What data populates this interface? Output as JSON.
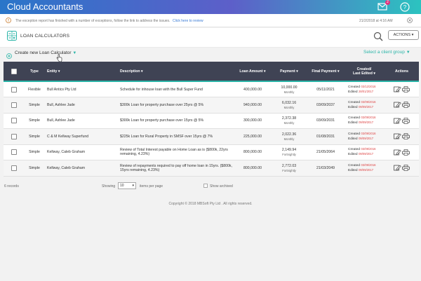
{
  "app": {
    "title": "Cloud Accountants",
    "mail_badge": "2"
  },
  "notice": {
    "message": "The exception report has finished with a number of exceptions, follow the link to address the issues.",
    "link": "Click here to review",
    "timestamp": "21/2/2018 at 4:16 AM"
  },
  "page": {
    "title": "LOAN CALCULATORS",
    "actions_label": "ACTIONS",
    "create_label": "Create new Loan Calculator",
    "client_group": "Select a client group"
  },
  "table": {
    "headers": {
      "type": "Type",
      "entity": "Entity",
      "description": "Description",
      "loan_amount": "Loan Amount",
      "payment": "Payment",
      "final_payment": "Final Payment",
      "created_line1": "Created/",
      "created_line2": "Last Edited",
      "actions": "Actions"
    },
    "rows": [
      {
        "type": "Flexible",
        "entity": "Bull Antics Pty Ltd",
        "description": "Schedule for inhouse loan with the Bull Super Fund",
        "loan_amount": "400,000.00",
        "payment": "10,000.00",
        "frequency": "Monthly",
        "final_payment": "05/11/2021",
        "created": "03/12/2016",
        "edited": "28/01/2017"
      },
      {
        "type": "Simple",
        "entity": "Bull, Ashlee Jade",
        "description": "$300k Loan for property purchase over 25yrs @ 5%",
        "loan_amount": "940,000.00",
        "payment": "6,032.16",
        "frequency": "Monthly",
        "final_payment": "03/09/2037",
        "created": "03/09/2016",
        "edited": "09/09/2017"
      },
      {
        "type": "Simple",
        "entity": "Bull, Ashlee Jade",
        "description": "$300k Loan for property purchase over 15yrs @ 5%",
        "loan_amount": "300,000.00",
        "payment": "2,372.38",
        "frequency": "Monthly",
        "final_payment": "03/09/2031",
        "created": "03/09/2016",
        "edited": "09/09/2017"
      },
      {
        "type": "Simple",
        "entity": "C & M Kellway Superfund",
        "description": "$225k Loan for Rural Property in SMSF over 15yrs @ 7%",
        "loan_amount": "225,000.00",
        "payment": "2,022.36",
        "frequency": "Monthly",
        "final_payment": "01/08/2031",
        "created": "03/09/2016",
        "edited": "09/09/2017"
      },
      {
        "type": "Simple",
        "entity": "Kellway, Caleb Graham",
        "description": "Review of Total Interest payable on Home Loan as is ($800k, 22yrs remaining, 4.23%)",
        "loan_amount": "800,000.00",
        "payment": "2,149.94",
        "frequency": "Fortnightly",
        "final_payment": "21/05/2064",
        "created": "03/09/2016",
        "edited": "09/09/2017"
      },
      {
        "type": "Simple",
        "entity": "Kellway, Caleb Graham",
        "description": "Review of repayments required to pay off home loan in 15yrs. ($800k, 15yrs remaining, 4.23%)",
        "loan_amount": "800,000.00",
        "payment": "2,772.03",
        "frequency": "Fortnightly",
        "final_payment": "21/03/2049",
        "created": "03/09/2016",
        "edited": "09/09/2017"
      }
    ],
    "created_prefix": "Created",
    "edited_prefix": "Edited"
  },
  "footer": {
    "records": "6 records",
    "showing": "Showing",
    "per_page_value": "10",
    "items_per_page": "items per page",
    "show_archived": "Show archived",
    "copyright": "Copyright © 2018 MBSoft Pty Ltd . All rights reserved."
  },
  "colors": {
    "accent": "#2bb5a8",
    "header_bg": "#3f4354",
    "link": "#3a7bd5"
  }
}
